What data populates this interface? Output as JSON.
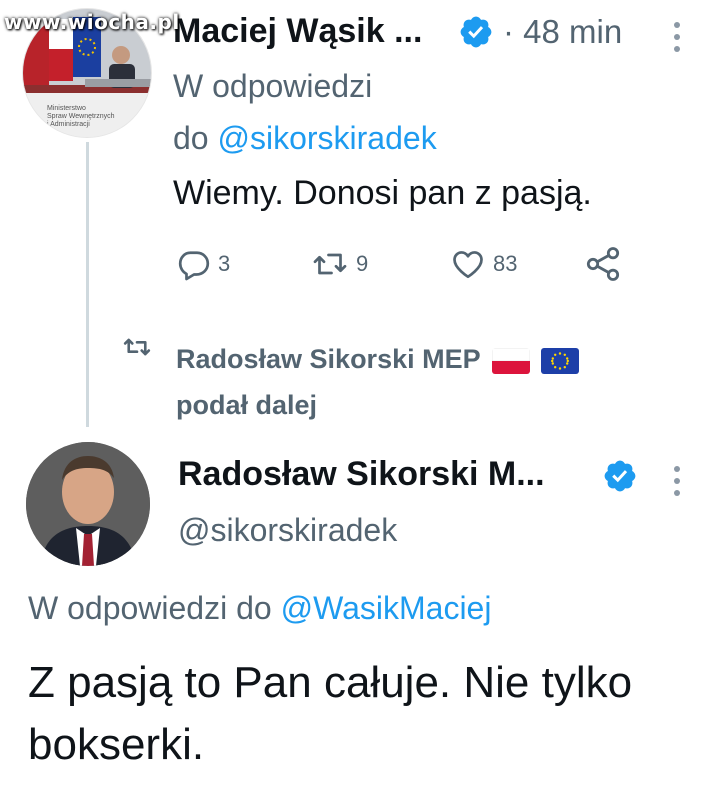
{
  "watermark": "www.wiocha.pl",
  "tweet1": {
    "author": "Maciej Wąsik ...",
    "time": "· 48 min",
    "reply_prefix": "W odpowiedzi",
    "reply_to_prefix": "do",
    "reply_to_handle": "@sikorskiradek",
    "text": "Wiemy. Donosi pan z pasją.",
    "avatar_caption": [
      "Ministerstwo",
      "Spraw Wewnętrznych",
      "i Administracji"
    ],
    "actions": {
      "replies": "3",
      "retweets": "9",
      "likes": "83"
    }
  },
  "retweet_banner": {
    "name": "Radosław Sikorski MEP",
    "suffix": "podał dalej",
    "flags": [
      "poland-flag",
      "eu-flag"
    ]
  },
  "tweet2": {
    "author": "Radosław Sikorski M...",
    "handle": "@sikorskiradek",
    "reply_prefix": "W odpowiedzi do",
    "reply_to_handle": "@WasikMaciej",
    "text": "Z pasją to Pan całuje.  Nie tylko bokserki."
  },
  "colors": {
    "text": "#0f1419",
    "secondary": "#536471",
    "link": "#1d9bf0",
    "verified": "#1d9bf0",
    "thread_line": "#cfd9de"
  },
  "icons": [
    "verified-badge-icon",
    "more-options-icon",
    "reply-icon",
    "retweet-icon",
    "like-icon",
    "share-icon"
  ]
}
